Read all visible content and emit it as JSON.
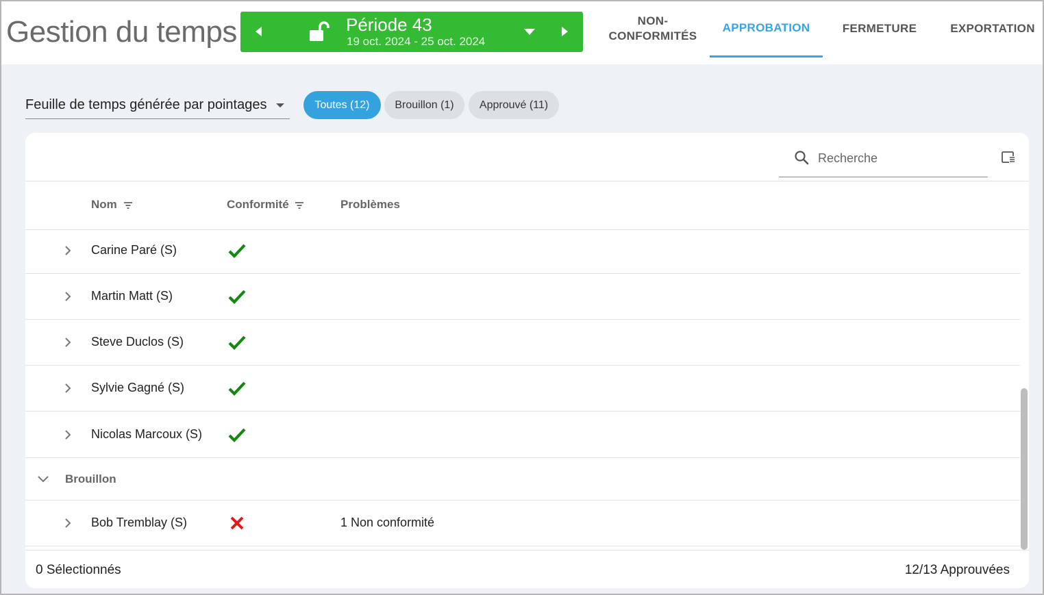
{
  "header": {
    "app_title": "Gestion du temps",
    "period": {
      "title": "Période 43",
      "dates": "19 oct. 2024 - 25 oct. 2024",
      "color": "#35ba34"
    },
    "tabs": [
      {
        "label": "NON-\nCONFORMITÉS",
        "line1": "NON-",
        "line2": "CONFORMITÉS"
      },
      {
        "label": "APPROBATION"
      },
      {
        "label": "FERMETURE"
      },
      {
        "label": "EXPORTATION"
      }
    ],
    "active_tab": "APPROBATION",
    "accent": "#3aa3e3"
  },
  "filters": {
    "view_select": "Feuille de temps générée par pointages",
    "chips": [
      {
        "label": "Toutes (12)"
      },
      {
        "label": "Brouillon (1)"
      },
      {
        "label": "Approuvé (11)"
      }
    ]
  },
  "card": {
    "search_placeholder": "Recherche",
    "columns": {
      "name": "Nom",
      "compliance": "Conformité",
      "problems": "Problèmes"
    },
    "rows": [
      {
        "name": "Carine Paré (S)",
        "status": "ok",
        "problem": ""
      },
      {
        "name": "Martin Matt (S)",
        "status": "ok",
        "problem": ""
      },
      {
        "name": "Steve Duclos (S)",
        "status": "ok",
        "problem": ""
      },
      {
        "name": "Sylvie Gagné (S)",
        "status": "ok",
        "problem": ""
      },
      {
        "name": "Nicolas Marcoux (S)",
        "status": "ok",
        "problem": ""
      }
    ],
    "group": {
      "label": "Brouillon",
      "rows": [
        {
          "name": "Bob Tremblay (S)",
          "status": "error",
          "problem": "1 Non conformité"
        }
      ]
    },
    "footer": {
      "selected": "0 Sélectionnés",
      "approved": "12/13 Approuvées"
    },
    "status_colors": {
      "ok": "#128a12",
      "error": "#e11b1b"
    }
  }
}
